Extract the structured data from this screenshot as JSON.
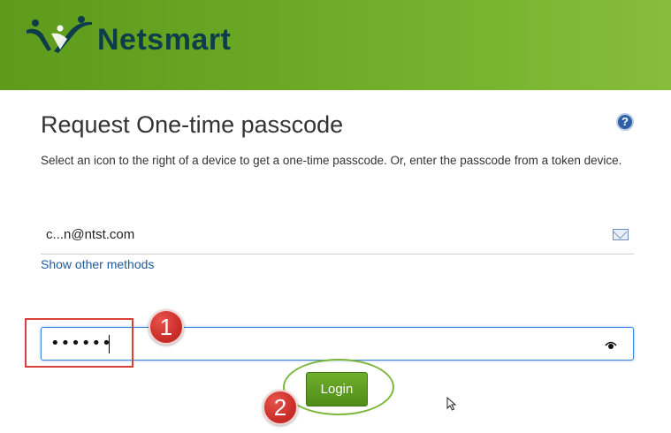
{
  "header": {
    "brand": "Netsmart",
    "colors": {
      "bar": "#6aa824",
      "brand_text": "#0d3d4a"
    },
    "logo_icon": "people-figures-logo"
  },
  "help": {
    "icon": "question-circle-icon",
    "label": "?"
  },
  "page": {
    "title": "Request One-time passcode",
    "subtitle": "Select an icon to the right of a device to get a one-time passcode. Or, enter the passcode from a token device."
  },
  "methods": {
    "email": "c...n@ntst.com",
    "email_icon": "envelope-icon",
    "show_other": "Show other methods"
  },
  "passcode": {
    "masked_value": "••••••",
    "toggle_icon": "eye-icon"
  },
  "actions": {
    "login_label": "Login",
    "login_color": "#5a9a20"
  },
  "annotations": {
    "step1": "1",
    "step2": "2",
    "marker_color": "#cc2f29",
    "ellipse_color": "#7cb83a"
  }
}
